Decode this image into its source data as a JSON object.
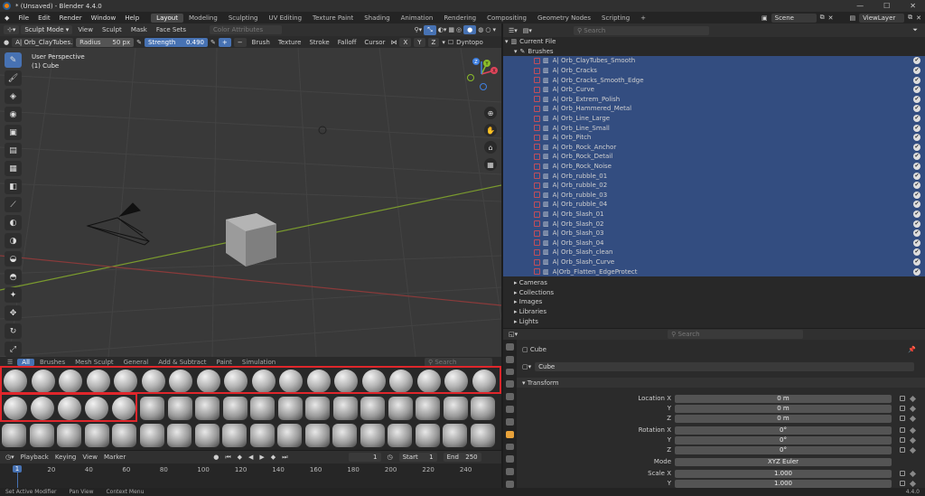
{
  "window": {
    "title": "* (Unsaved) - Blender 4.4.0",
    "controls": [
      "—",
      "☐",
      "✕"
    ]
  },
  "menu": {
    "items": [
      "File",
      "Edit",
      "Render",
      "Window",
      "Help"
    ]
  },
  "workspaces": [
    {
      "label": "Layout",
      "active": true
    },
    {
      "label": "Modeling"
    },
    {
      "label": "Sculpting"
    },
    {
      "label": "UV Editing"
    },
    {
      "label": "Texture Paint"
    },
    {
      "label": "Shading"
    },
    {
      "label": "Animation"
    },
    {
      "label": "Rendering"
    },
    {
      "label": "Compositing"
    },
    {
      "label": "Geometry Nodes"
    },
    {
      "label": "Scripting"
    },
    {
      "label": "+"
    }
  ],
  "scene": {
    "name": "Scene",
    "view_layer": "ViewLayer"
  },
  "viewport_header": {
    "mode": "Sculpt Mode",
    "menus": [
      "View",
      "Sculpt",
      "Mask",
      "Face Sets"
    ],
    "color_attributes": "Color Attributes"
  },
  "tool_settings": {
    "brush_name": "A| Orb_ClayTubes...",
    "radius_label": "Radius",
    "radius_value": "50 px",
    "strength_label": "Strength",
    "strength_value": "0.490",
    "menus": [
      "Brush",
      "Texture",
      "Stroke",
      "Falloff",
      "Cursor"
    ],
    "axes": [
      "X",
      "Y",
      "Z"
    ],
    "dyntopo": "Dyntopo"
  },
  "viewport": {
    "line1": "User Perspective",
    "line2": "(1) Cube"
  },
  "gizmo": {
    "x": "X",
    "y": "Y",
    "z": "Z"
  },
  "shelf": {
    "tabs": [
      {
        "label": "All",
        "active": true
      },
      {
        "label": "Brushes"
      },
      {
        "label": "Mesh Sculpt"
      },
      {
        "label": "General"
      },
      {
        "label": "Add & Subtract"
      },
      {
        "label": "Paint"
      },
      {
        "label": "Simulation"
      }
    ],
    "search_placeholder": "Search"
  },
  "timeline": {
    "menus": [
      "Playback",
      "Keying",
      "View",
      "Marker"
    ],
    "current_frame": "1",
    "start_label": "Start",
    "start": "1",
    "end_label": "End",
    "end": "250",
    "ticks": [
      "1",
      "20",
      "40",
      "60",
      "80",
      "100",
      "120",
      "140",
      "160",
      "180",
      "200",
      "220",
      "240"
    ]
  },
  "status": {
    "items": [
      "Set Active Modifier",
      "Pan View",
      "Context Menu"
    ],
    "version": "4.4.0"
  },
  "outliner": {
    "search_placeholder": "Search",
    "root": "Current File",
    "group": "Brushes",
    "brushes": [
      "A| Orb_ClayTubes_Smooth",
      "A| Orb_Cracks",
      "A| Orb_Cracks_Smooth_Edge",
      "A| Orb_Curve",
      "A| Orb_Extrem_Polish",
      "A| Orb_Hammered_Metal",
      "A| Orb_Line_Large",
      "A| Orb_Line_Small",
      "A| Orb_Pitch",
      "A| Orb_Rock_Anchor",
      "A| Orb_Rock_Detail",
      "A| Orb_Rock_Noise",
      "A| Orb_rubble_01",
      "A| Orb_rubble_02",
      "A| Orb_rubble_03",
      "A| Orb_rubble_04",
      "A| Orb_Slash_01",
      "A| Orb_Slash_02",
      "A| Orb_Slash_03",
      "A| Orb_Slash_04",
      "A| Orb_Slash_clean",
      "A| Orb_Slash_Curve",
      "A|Orb_Flatten_EdgeProtect"
    ],
    "collapsed": [
      "Cameras",
      "Collections",
      "Images",
      "Libraries",
      "Lights"
    ]
  },
  "properties": {
    "search_placeholder": "Search",
    "object": "Cube",
    "object_name": "Cube",
    "panel": "Transform",
    "rows": [
      {
        "label": "Location X",
        "value": "0 m"
      },
      {
        "label": "Y",
        "value": "0 m"
      },
      {
        "label": "Z",
        "value": "0 m"
      },
      {
        "label": "Rotation X",
        "value": "0°"
      },
      {
        "label": "Y",
        "value": "0°"
      },
      {
        "label": "Z",
        "value": "0°"
      },
      {
        "label": "Mode",
        "value": "XYZ Euler"
      },
      {
        "label": "Scale X",
        "value": "1.000"
      },
      {
        "label": "Y",
        "value": "1.000"
      }
    ]
  },
  "colors": {
    "accent": "#4772b3",
    "highlight": "#e0262b",
    "selection": "#334d80"
  }
}
